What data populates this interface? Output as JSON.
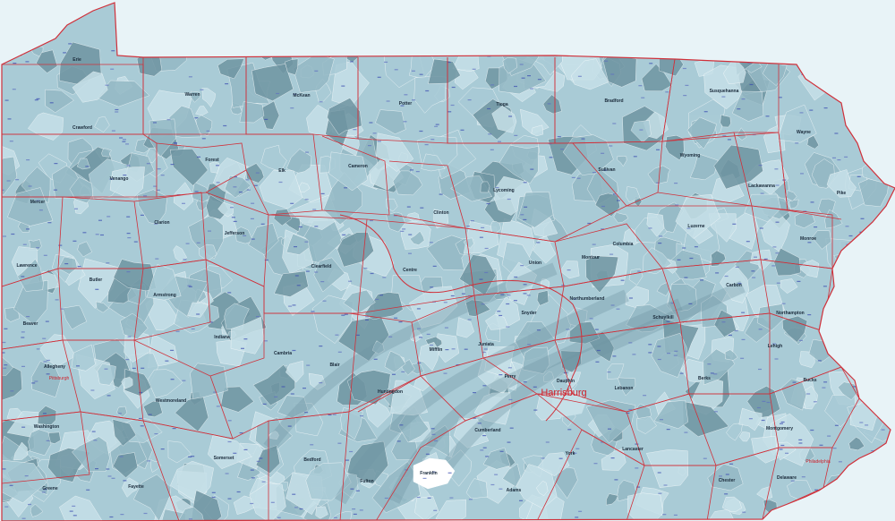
{
  "map": {
    "colors": {
      "background": "#e8f3f7",
      "state_fill": "#a9cbd6",
      "zone_light": "#c6e0e8",
      "zone_mid": "#94b9c5",
      "zone_dark": "#6f95a2",
      "county_border": "#d0303a",
      "zip_border": "#ffffff",
      "county_label": "#1a2a3a",
      "capital_label": "#d0202a"
    },
    "capital": "Harrisburg",
    "cities": [
      "Pittsburgh",
      "Philadelphia"
    ],
    "counties": [
      "Erie",
      "Crawford",
      "Warren",
      "McKean",
      "Potter",
      "Tioga",
      "Bradford",
      "Susquehanna",
      "Wayne",
      "Pike",
      "Forest",
      "Venango",
      "Mercer",
      "Elk",
      "Cameron",
      "Lycoming",
      "Sullivan",
      "Wyoming",
      "Lackawanna",
      "Clinton",
      "Clarion",
      "Jefferson",
      "Lawrence",
      "Butler",
      "Clearfield",
      "Centre",
      "Union",
      "Montour",
      "Columbia",
      "Luzerne",
      "Monroe",
      "Armstrong",
      "Beaver",
      "Indiana",
      "Northumberland",
      "Snyder",
      "Carbon",
      "Schuylkill",
      "Northampton",
      "Allegheny",
      "Cambria",
      "Blair",
      "Mifflin",
      "Juniata",
      "Lehigh",
      "Westmoreland",
      "Huntingdon",
      "Perry",
      "Dauphin",
      "Lebanon",
      "Berks",
      "Bucks",
      "Washington",
      "Somerset",
      "Bedford",
      "Fulton",
      "Franklin",
      "Cumberland",
      "York",
      "Lancaster",
      "Chester",
      "Montgomery",
      "Delaware",
      "Adams",
      "Greene",
      "Fayette"
    ]
  }
}
